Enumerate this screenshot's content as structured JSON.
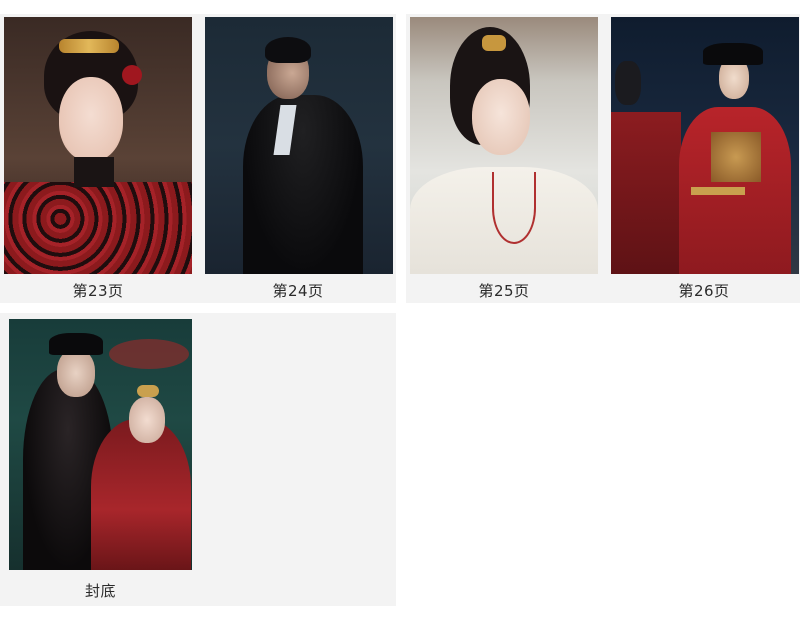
{
  "gallery": {
    "items": [
      {
        "caption": "第23页"
      },
      {
        "caption": "第24页"
      },
      {
        "caption": "第25页"
      },
      {
        "caption": "第26页"
      },
      {
        "caption": "封底"
      }
    ]
  }
}
